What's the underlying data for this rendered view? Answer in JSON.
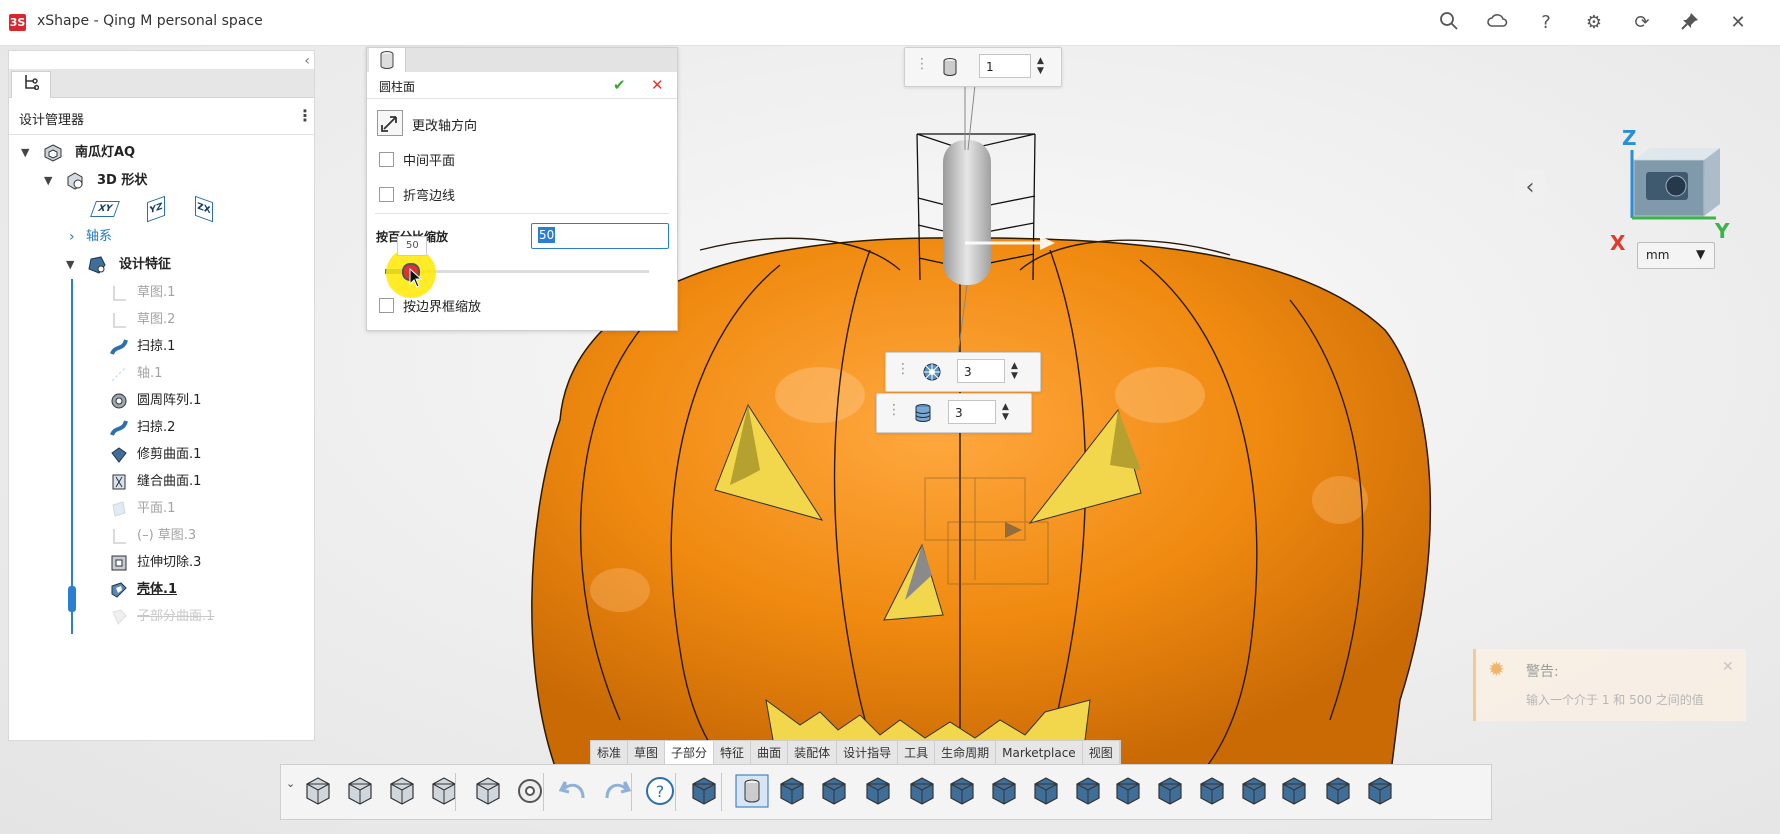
{
  "app": {
    "logo_text": "3S",
    "title": "xShape - Qing M personal space"
  },
  "titlebar_icons": [
    "search-icon",
    "cloud-icon",
    "help-icon",
    "gear-icon",
    "refresh-icon",
    "pin-icon",
    "close-icon"
  ],
  "left_panel": {
    "collapse_glyph": "‹",
    "header": "设计管理器",
    "tree": {
      "root": "南瓜灯AQ",
      "shape": "3D 形状",
      "planes": [
        "XY",
        "YZ",
        "ZX"
      ],
      "axes": "轴系",
      "features_group": "设计特征",
      "features": [
        {
          "label": "草图.1",
          "state": "suppressed"
        },
        {
          "label": "草图.2",
          "state": "suppressed"
        },
        {
          "label": "扫掠.1",
          "state": "active"
        },
        {
          "label": "轴.1",
          "state": "suppressed"
        },
        {
          "label": "圆周阵列.1",
          "state": "active"
        },
        {
          "label": "扫掠.2",
          "state": "active"
        },
        {
          "label": "修剪曲面.1",
          "state": "active"
        },
        {
          "label": "缝合曲面.1",
          "state": "active"
        },
        {
          "label": "平面.1",
          "state": "suppressed"
        },
        {
          "label": "(–)  草图.3",
          "state": "suppressed"
        },
        {
          "label": "拉伸切除.3",
          "state": "active"
        },
        {
          "label": "壳体.1",
          "state": "current"
        },
        {
          "label": "子部分曲面.1",
          "state": "rolled-back"
        }
      ]
    }
  },
  "dialog": {
    "title": "圆柱面",
    "ok": "✔",
    "cancel": "✕",
    "change_axis": "更改轴方向",
    "mid_plane": "中间平面",
    "fold_edge": "折弯边线",
    "scale_label": "按百分比缩放",
    "scale_value": "50",
    "slider_tip": "50",
    "slider_fraction": 0.1,
    "bbox_scale": "按边界框缩放"
  },
  "mini_toolbars": [
    {
      "icon": "cylinder-icon",
      "value": "1"
    },
    {
      "icon": "radial-count-icon",
      "value": "3"
    },
    {
      "icon": "stack-count-icon",
      "value": "3"
    }
  ],
  "view_cube": {
    "x": "X",
    "y": "Y",
    "z": "Z"
  },
  "units": "mm",
  "warning": {
    "title": "警告:",
    "message": "输入一个介于 1 和 500 之间的值"
  },
  "ribbon_tabs": [
    "标准",
    "草图",
    "子部分",
    "特征",
    "曲面",
    "装配体",
    "设计指导",
    "工具",
    "生命周期",
    "Marketplace",
    "视图"
  ],
  "ribbon_selected": "子部分",
  "colors": {
    "pumpkin": "#f08a10",
    "accent_blue": "#2b7fd1",
    "ok_green": "#3aa63a",
    "cancel_red": "#e03a2f"
  }
}
